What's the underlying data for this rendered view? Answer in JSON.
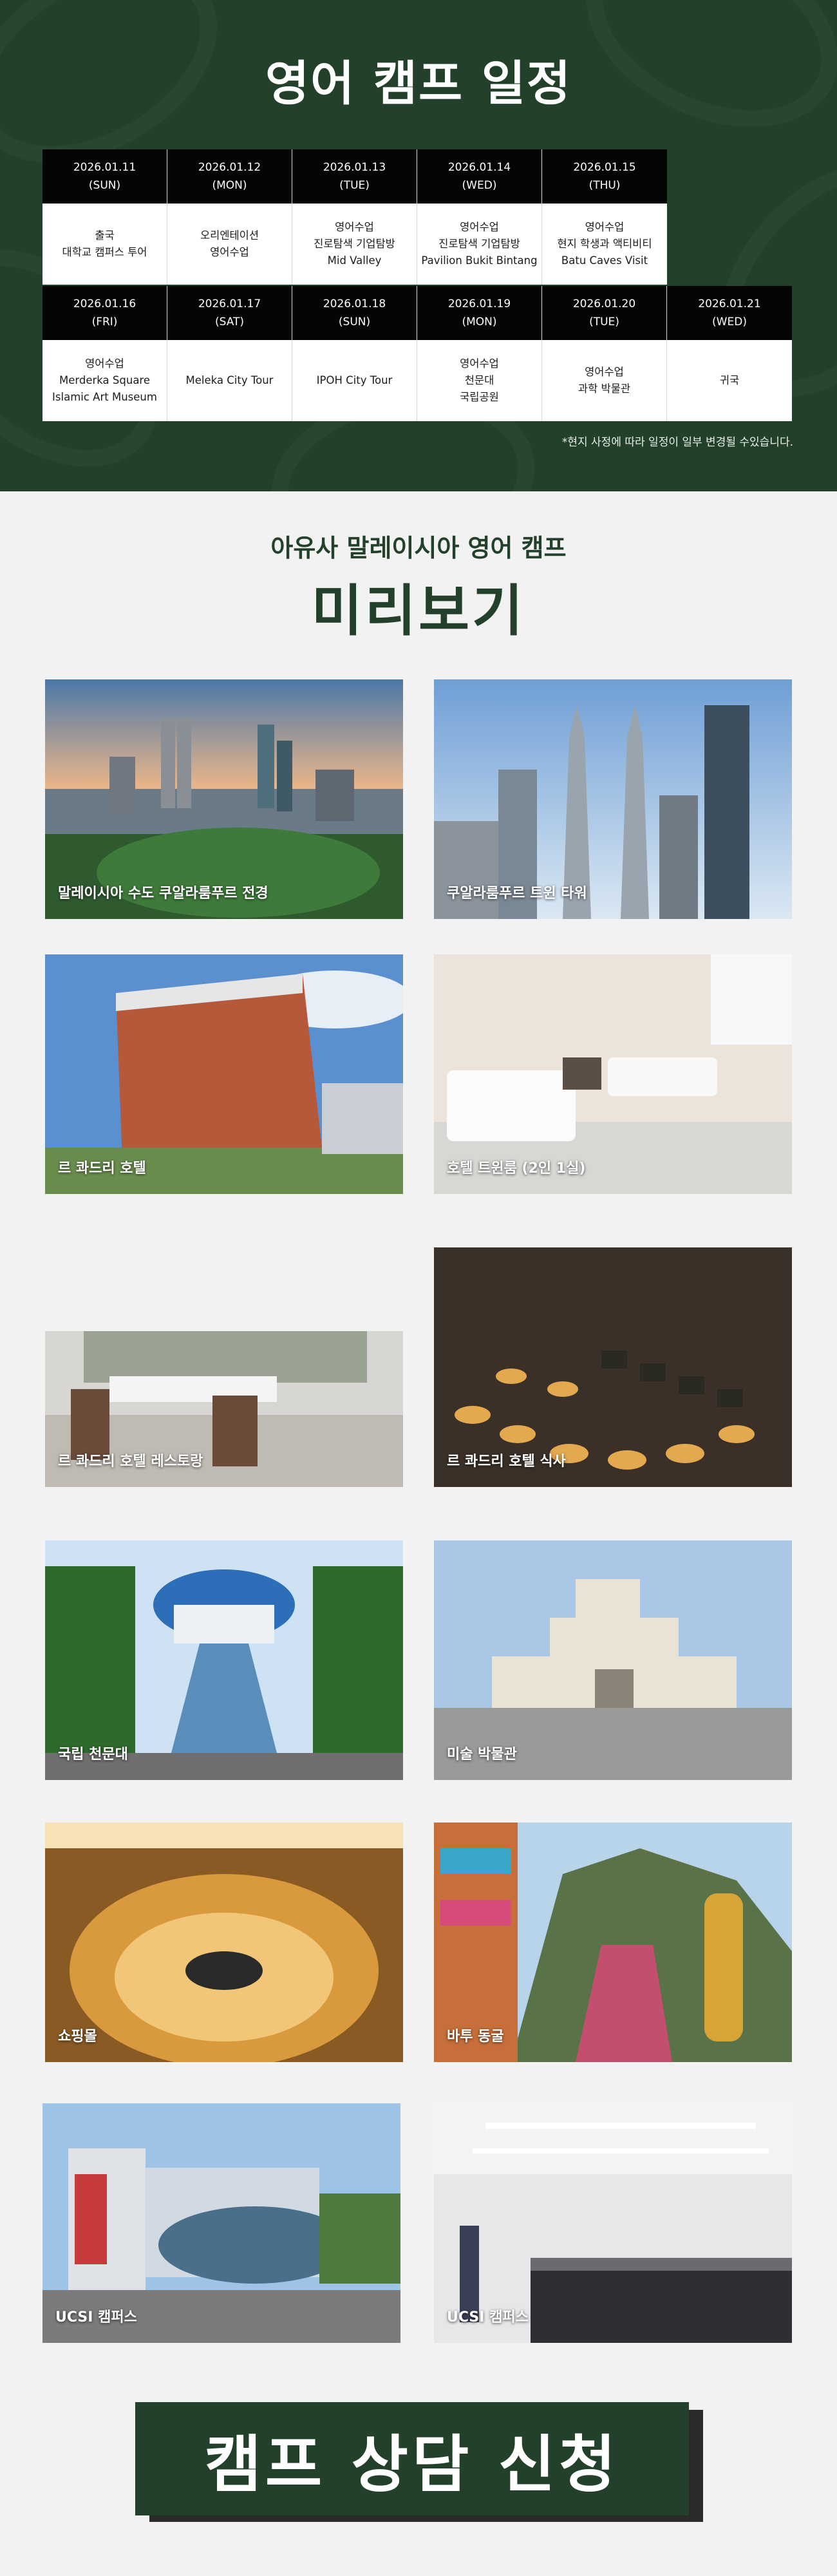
{
  "schedule": {
    "title": "영어 캠프 일정",
    "note": "*현지 사정에 따라 일정이 일부 변경될 수있습니다.",
    "week1": [
      {
        "date": "2026.01.11",
        "day": "(SUN)",
        "lines": [
          "출국",
          "대학교 캠퍼스 투어"
        ]
      },
      {
        "date": "2026.01.12",
        "day": "(MON)",
        "lines": [
          "오리엔테이션",
          "영어수업"
        ]
      },
      {
        "date": "2026.01.13",
        "day": "(TUE)",
        "lines": [
          "영어수업",
          "진로탐색 기업탐방",
          "Mid Valley"
        ]
      },
      {
        "date": "2026.01.14",
        "day": "(WED)",
        "lines": [
          "영어수업",
          "진로탐색 기업탐방",
          "Pavilion Bukit Bintang"
        ]
      },
      {
        "date": "2026.01.15",
        "day": "(THU)",
        "lines": [
          "영어수업",
          "현지 학생과 액티비티",
          "Batu Caves Visit"
        ]
      }
    ],
    "week2": [
      {
        "date": "2026.01.16",
        "day": "(FRI)",
        "lines": [
          "영어수업",
          "Merderka Square",
          "Islamic Art Museum"
        ]
      },
      {
        "date": "2026.01.17",
        "day": "(SAT)",
        "lines": [
          "Meleka City Tour"
        ]
      },
      {
        "date": "2026.01.18",
        "day": "(SUN)",
        "lines": [
          "IPOH City Tour"
        ]
      },
      {
        "date": "2026.01.19",
        "day": "(MON)",
        "lines": [
          "영어수업",
          "천문대",
          "국립공원"
        ]
      },
      {
        "date": "2026.01.20",
        "day": "(TUE)",
        "lines": [
          "영어수업",
          "과학 박물관"
        ]
      },
      {
        "date": "2026.01.21",
        "day": "(WED)",
        "lines": [
          "귀국"
        ]
      }
    ]
  },
  "preview": {
    "subtitle": "아유사 말레이시아 영어 캠프",
    "title": "미리보기",
    "photos": [
      "말레이시아 수도 쿠알라룸푸르 전경",
      "쿠알라룸푸르 트윈 타워",
      "르 콰드리 호텔",
      "호텔 트윈룸 (2인 1실)",
      "르 콰드리 호텔 레스토랑",
      "르 콰드리 호텔 식사",
      "국립 천문대",
      "미술 박물관",
      "쇼핑몰",
      "바투 동굴",
      "UCSI 캠퍼스",
      "UCSI 캠퍼스"
    ]
  },
  "cta": {
    "label": "캠프 상담 신청"
  },
  "colors": {
    "brand_green": "#22402a",
    "header_black": "#050505",
    "background": "#f2f2f2"
  }
}
